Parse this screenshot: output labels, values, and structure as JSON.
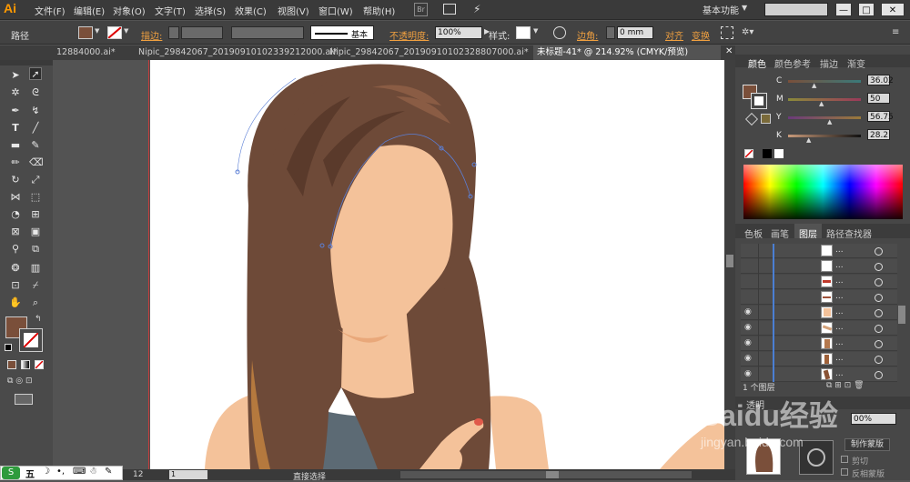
{
  "app": {
    "logo": "Ai"
  },
  "menu": [
    "文件(F)",
    "编辑(E)",
    "对象(O)",
    "文字(T)",
    "选择(S)",
    "效果(C)",
    "视图(V)",
    "窗口(W)",
    "帮助(H)"
  ],
  "menubar_icons": {
    "bridge": "Br"
  },
  "workspace": {
    "label": "基本功能"
  },
  "window_buttons": {
    "minimize": "—",
    "maximize": "□",
    "close": "✕"
  },
  "controlbar": {
    "object_type": "路径",
    "stroke_label": "描边:",
    "stroke_style": "基本",
    "opacity_label": "不透明度:",
    "opacity_value": "100%",
    "style_label": "样式:",
    "corner_label": "边角:",
    "corner_value": "0 mm",
    "align_label": "对齐",
    "transform_label": "变换"
  },
  "tabs": [
    {
      "label": "12884000.ai*",
      "active": false
    },
    {
      "label": "Nipic_29842067_20190910102339212000.ai*",
      "active": false
    },
    {
      "label": "Nipic_29842067_20190910102328807000.ai*",
      "active": false
    },
    {
      "label": "未标题-41* @ 214.92% (CMYK/预览)",
      "active": true
    }
  ],
  "color_panel": {
    "tabs": [
      "颜色",
      "颜色参考",
      "描边",
      "渐变"
    ],
    "channels": [
      {
        "name": "C",
        "value": "36.02"
      },
      {
        "name": "M",
        "value": "50"
      },
      {
        "name": "Y",
        "value": "56.75"
      },
      {
        "name": "K",
        "value": "28.2"
      }
    ],
    "fill_color": "#7a4f3a"
  },
  "layers_panel": {
    "tabs": [
      "色板",
      "画笔",
      "图层",
      "路径查找器"
    ],
    "footer": "1 个图层",
    "rows": [
      {
        "eye": false,
        "thumb": "#ffffff",
        "dots": "..."
      },
      {
        "eye": false,
        "thumb": "#ffffff",
        "dots": "..."
      },
      {
        "eye": false,
        "thumb": "#c0392b",
        "dots": "..."
      },
      {
        "eye": false,
        "thumb": "#ffffff",
        "dots": "..."
      },
      {
        "eye": true,
        "thumb": "#f4c29a",
        "dots": "..."
      },
      {
        "eye": true,
        "thumb": "#d4a27a",
        "dots": "..."
      },
      {
        "eye": true,
        "thumb": "#b5794e",
        "dots": "..."
      },
      {
        "eye": true,
        "thumb": "#a0623a",
        "dots": "..."
      },
      {
        "eye": true,
        "thumb": "#8a5335",
        "dots": "..."
      }
    ]
  },
  "transparency_panel": {
    "tab": "透明",
    "opacity_value": "00%",
    "make_mask_button": "制作蒙版",
    "clip_label": "剪切",
    "invert_label": "反相蒙版"
  },
  "statusbar": {
    "zoom": "12",
    "page": "1",
    "tool_name": "直接选择"
  },
  "ime": {
    "label": "五"
  },
  "watermark": {
    "brand": "Baidu经验",
    "url": "jingyan.baidu.com"
  },
  "colors": {
    "hair": "#6e4a38",
    "hair_dark": "#5a3a2b",
    "skin": "#f4c29a",
    "skin_shadow": "#e9a87a",
    "shirt": "#5c6a74",
    "accent": "#f0a040"
  }
}
